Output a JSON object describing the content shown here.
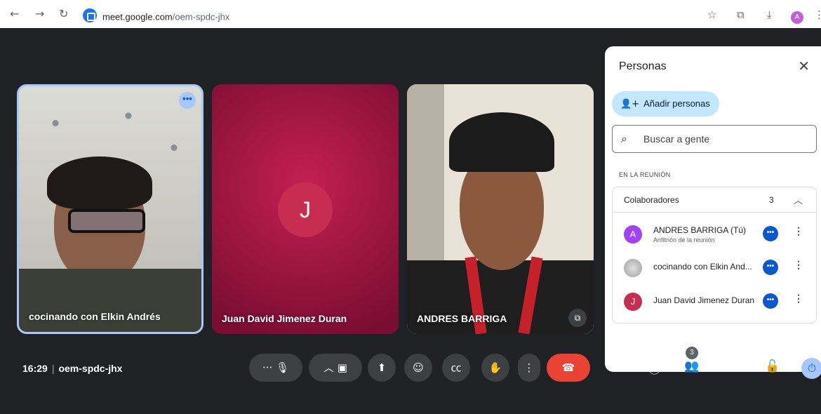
{
  "browser": {
    "url_host": "meet.google.com",
    "url_path": "/oem-spdc-jhx",
    "profile_initial": "A"
  },
  "tiles": [
    {
      "name": "cocinando con Elkin Andrés"
    },
    {
      "name": "Juan David Jimenez Duran",
      "initial": "J"
    },
    {
      "name": "ANDRES BARRIGA"
    }
  ],
  "people_panel": {
    "title": "Personas",
    "add_people_label": "Añadir personas",
    "search_placeholder": "Buscar a gente",
    "section_label": "EN LA REUNIÓN",
    "group": {
      "title": "Colaboradores",
      "count": "3",
      "participants": [
        {
          "name": "ANDRES BARRIGA (Tú)",
          "role": "Anfitrión de la reunión",
          "initial": "A",
          "color": "#a142f4"
        },
        {
          "name": "cocinando con Elkin And...",
          "role": "",
          "initial": "",
          "color": "#bdbdbd"
        },
        {
          "name": "Juan David Jimenez Duran",
          "role": "",
          "initial": "J",
          "color": "#c72c51"
        }
      ]
    }
  },
  "bottom_bar": {
    "time": "16:29",
    "meeting_code": "oem-spdc-jhx",
    "participant_count": "3"
  },
  "colors": {
    "background": "#202124",
    "accent": "#a8c7fa",
    "end_call": "#ea4335",
    "add_button": "#c2e7ff"
  }
}
